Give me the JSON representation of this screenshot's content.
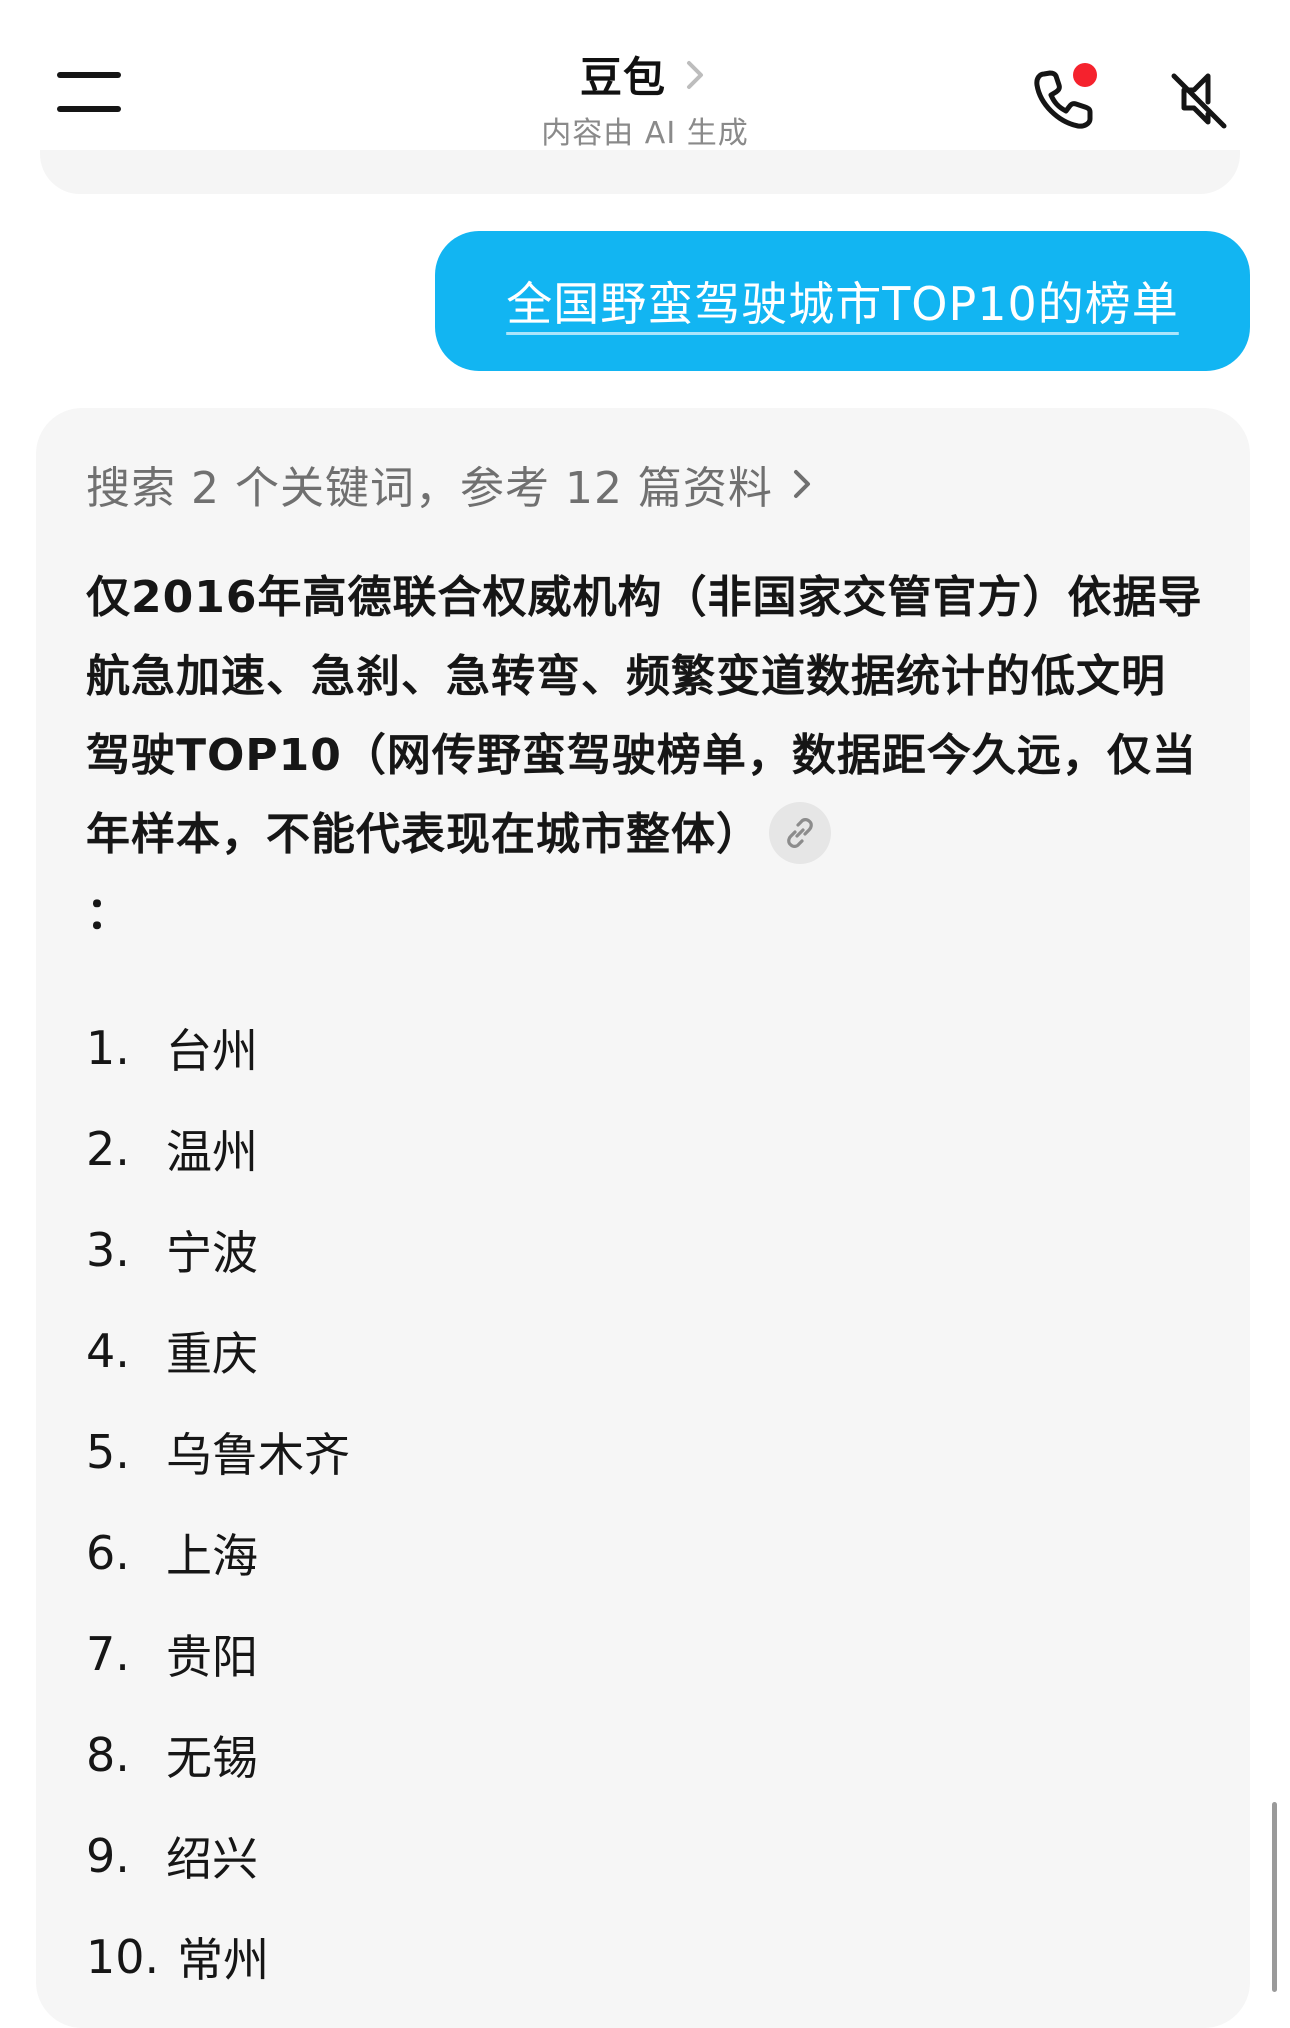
{
  "header": {
    "title": "豆包",
    "subtitle": "内容由 AI 生成",
    "icons": {
      "menu": "menu-icon",
      "phone": "phone-icon",
      "mute": "speaker-mute-icon"
    },
    "notification_dot_color": "#f5222d"
  },
  "user_message": {
    "text": "全国野蛮驾驶城市TOP10的榜单",
    "bubble_color": "#12b5f2"
  },
  "answer": {
    "search_summary": "搜索 2 个关键词，参考 12 篇资料",
    "intro": "仅2016年高德联合权威机构（非国家交管官方）依据导航急加速、急刹、急转弯、频繁变道数据统计的低文明驾驶TOP10（网传野蛮驾驶榜单，数据距今久远，仅当年样本，不能代表现在城市整体）",
    "intro_end": "：",
    "ranking": [
      {
        "num": "1.",
        "city": "台州"
      },
      {
        "num": "2.",
        "city": "温州"
      },
      {
        "num": "3.",
        "city": "宁波"
      },
      {
        "num": "4.",
        "city": "重庆"
      },
      {
        "num": "5.",
        "city": "乌鲁木齐"
      },
      {
        "num": "6.",
        "city": "上海"
      },
      {
        "num": "7.",
        "city": "贵阳"
      },
      {
        "num": "8.",
        "city": "无锡"
      },
      {
        "num": "9.",
        "city": "绍兴"
      },
      {
        "num": "10.",
        "city": "常州"
      }
    ]
  }
}
